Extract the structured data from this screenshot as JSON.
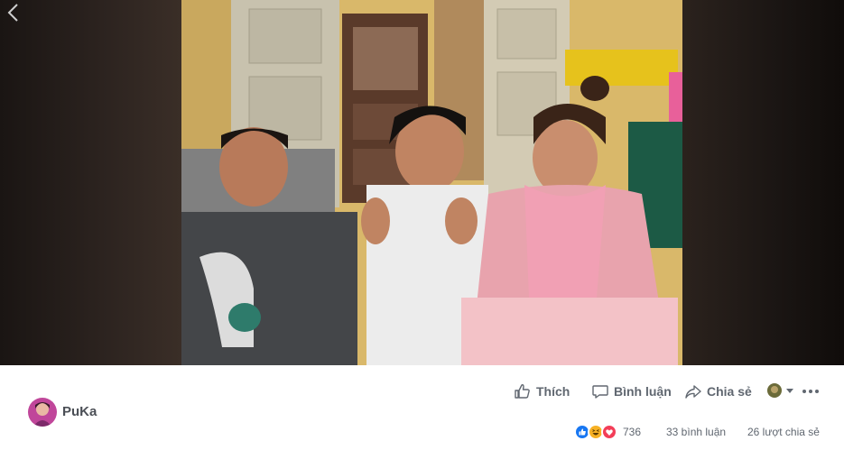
{
  "post": {
    "page_name": "PuKa",
    "avatar_icon": "profile-avatar"
  },
  "actions": {
    "like_label": "Thích",
    "comment_label": "Bình luận",
    "share_label": "Chia sẻ"
  },
  "stats": {
    "reaction_icons": [
      "like-icon",
      "haha-icon",
      "love-icon"
    ],
    "reaction_count": "736",
    "comments": "33 bình luận",
    "shares": "26 lượt chia sẻ"
  },
  "colors": {
    "like_blue": "#1877f2",
    "love_red": "#f33e58",
    "haha_yellow": "#f7b125",
    "text_gray": "#606770"
  }
}
